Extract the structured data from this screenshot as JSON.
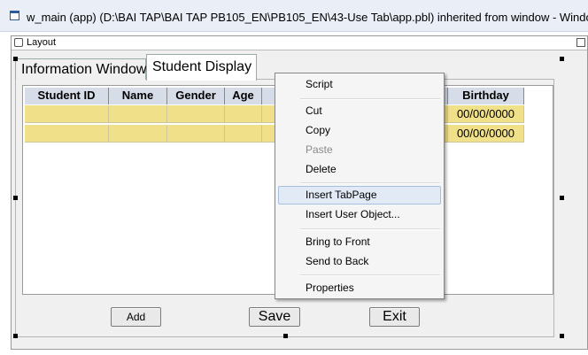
{
  "window": {
    "title": "w_main (app) (D:\\BAI TAP\\BAI TAP PB105_EN\\PB105_EN\\43-Use Tab\\app.pbl) inherited from window - Window",
    "icon": "window-icon"
  },
  "layout": {
    "title": "Layout"
  },
  "tabs": [
    {
      "label": "Information Window"
    },
    {
      "label": "Student Display"
    }
  ],
  "grid": {
    "columns": [
      {
        "label": "Student ID"
      },
      {
        "label": "Name"
      },
      {
        "label": "Gender"
      },
      {
        "label": "Age"
      },
      {
        "label": ""
      },
      {
        "label": "Birthday"
      }
    ],
    "rows": [
      [
        "",
        "",
        "",
        "",
        "",
        "00/00/0000"
      ],
      [
        "",
        "",
        "",
        "",
        "",
        "00/00/0000"
      ]
    ]
  },
  "buttons": {
    "add": "Add",
    "save": "Save",
    "exit": "Exit"
  },
  "context_menu": {
    "items": [
      {
        "label": "Script"
      },
      {
        "label": "Cut"
      },
      {
        "label": "Copy"
      },
      {
        "label": "Paste",
        "disabled": true
      },
      {
        "label": "Delete"
      },
      {
        "label": "Insert TabPage",
        "highlighted": true
      },
      {
        "label": "Insert User Object..."
      },
      {
        "label": "Bring to Front"
      },
      {
        "label": "Send to Back"
      },
      {
        "label": "Properties"
      }
    ]
  },
  "colors": {
    "grid_header": "#d6dde8",
    "grid_cell": "#f0e08a",
    "menu_highlight": "#e2eaf5"
  }
}
